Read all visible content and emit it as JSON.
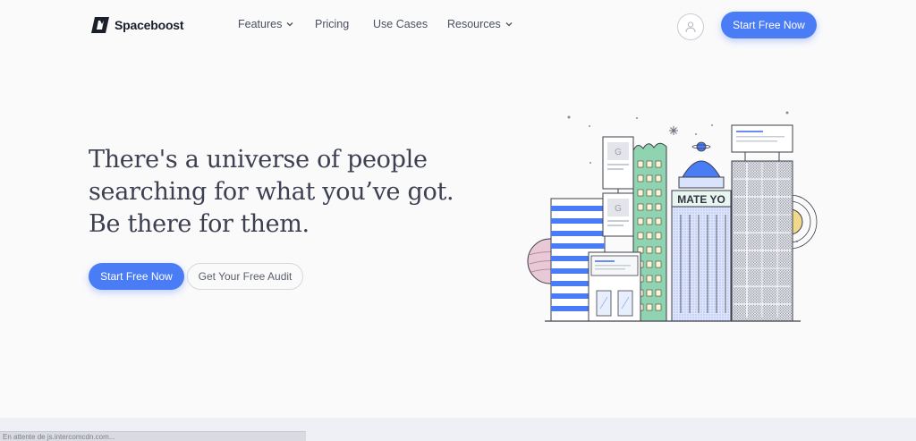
{
  "brand": {
    "name": "Spaceboost"
  },
  "nav": {
    "features": "Features",
    "pricing": "Pricing",
    "use_cases": "Use Cases",
    "resources": "Resources"
  },
  "header": {
    "cta_label": "Start Free Now"
  },
  "hero": {
    "line1": "There's a universe of people",
    "line2": "searching for what you’ve got.",
    "line3": "Be there for them.",
    "primary_cta": "Start Free Now",
    "secondary_cta": "Get Your Free Audit"
  },
  "illustration": {
    "billboard_text": "MATE YO",
    "card_letter": "G"
  },
  "status_bar": {
    "text": "En attente de js.intercomcdn.com..."
  },
  "colors": {
    "accent": "#4a7cf6",
    "text_dark": "#3c4050",
    "background": "#fafafb"
  },
  "icons": {
    "logo": "spaceboost-logo-icon",
    "chevron": "chevron-down-icon",
    "avatar": "user-icon"
  }
}
